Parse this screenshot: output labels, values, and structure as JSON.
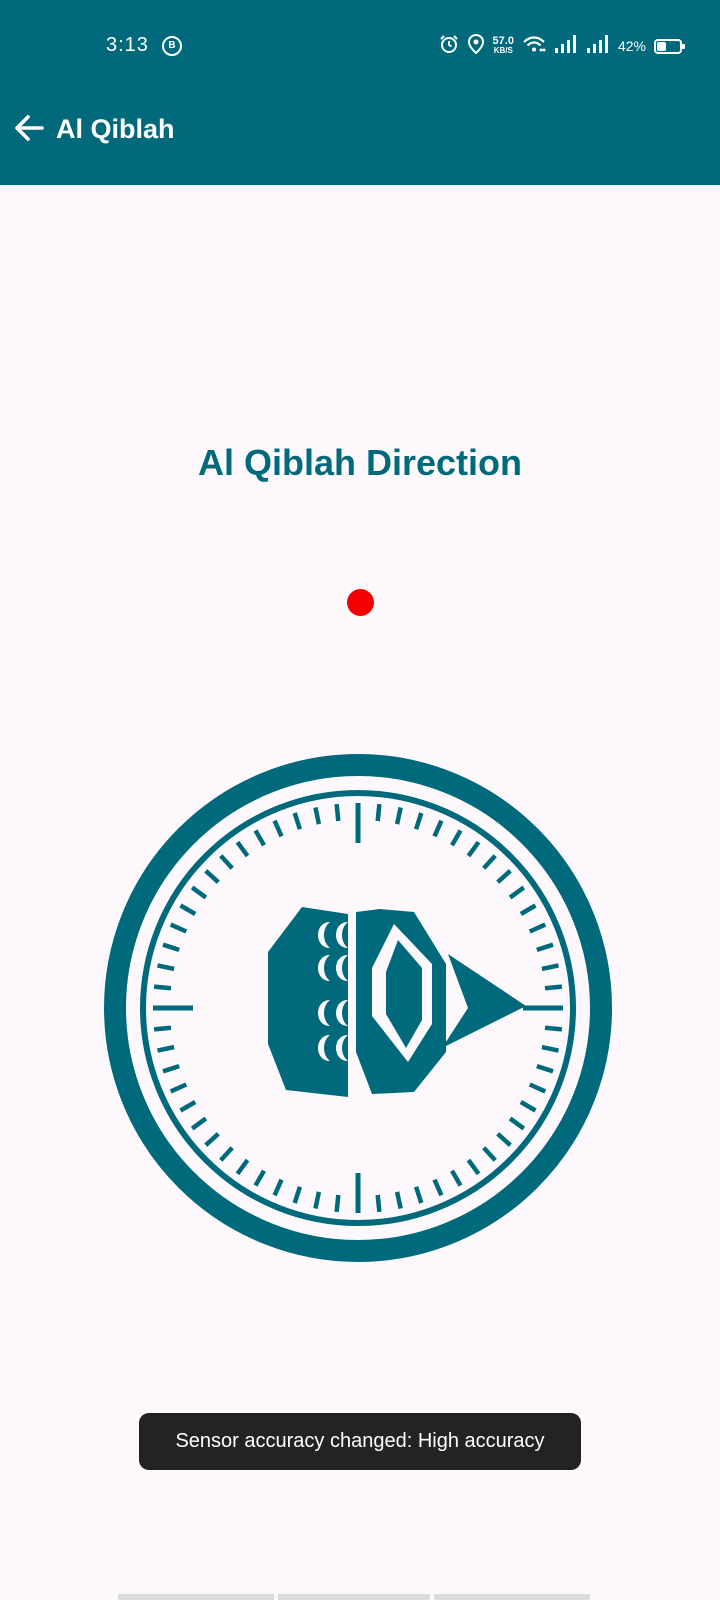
{
  "status_bar": {
    "time": "3:13",
    "badge": "B",
    "net_speed_value": "57.0",
    "net_speed_unit": "KB/S",
    "battery_percent": "42%",
    "battery_level": 0.42
  },
  "app_bar": {
    "back_icon": "arrow-left-icon",
    "title": "Al Qiblah"
  },
  "main": {
    "heading": "Al Qiblah Direction",
    "indicator_color": "#f40000"
  },
  "compass": {
    "icon": "kaaba-compass-icon",
    "color": "#006a7c"
  },
  "toast": {
    "message": "Sensor accuracy changed: High accuracy"
  },
  "colors": {
    "primary": "#006a7c",
    "background": "#fcf8fc",
    "toast_bg": "#232323"
  }
}
